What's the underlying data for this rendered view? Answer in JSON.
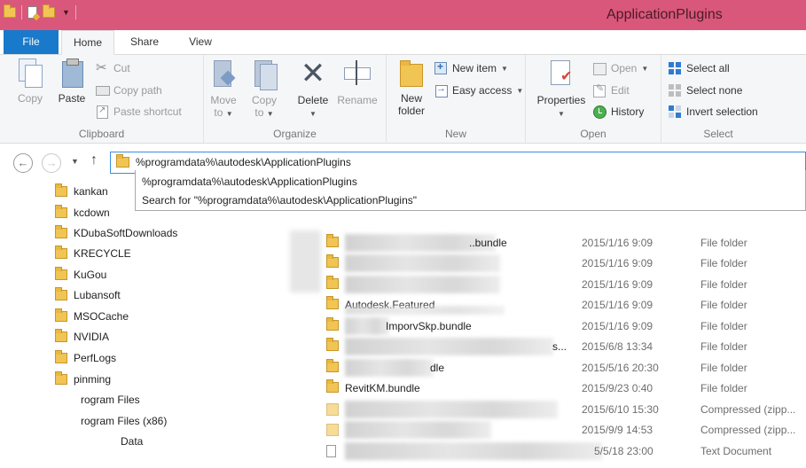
{
  "window": {
    "title": "ApplicationPlugins"
  },
  "tabs": {
    "file": "File",
    "home": "Home",
    "share": "Share",
    "view": "View"
  },
  "ribbon": {
    "clipboard": {
      "label": "Clipboard",
      "copy": "Copy",
      "paste": "Paste",
      "cut": "Cut",
      "copy_path": "Copy path",
      "paste_shortcut": "Paste shortcut"
    },
    "organize": {
      "label": "Organize",
      "move_to_line1": "Move",
      "move_to_line2": "to",
      "copy_to_line1": "Copy",
      "copy_to_line2": "to",
      "delete": "Delete",
      "rename": "Rename"
    },
    "new": {
      "label": "New",
      "new_folder_line1": "New",
      "new_folder_line2": "folder",
      "new_item": "New item",
      "easy_access": "Easy access"
    },
    "open": {
      "label": "Open",
      "properties": "Properties",
      "open": "Open",
      "edit": "Edit",
      "history": "History"
    },
    "select": {
      "label": "Select",
      "select_all": "Select all",
      "select_none": "Select none",
      "invert_selection": "Invert selection"
    }
  },
  "address": {
    "value": "%programdata%\\autodesk\\ApplicationPlugins",
    "suggestions": [
      "%programdata%\\autodesk\\ApplicationPlugins",
      "Search for \"%programdata%\\autodesk\\ApplicationPlugins\""
    ]
  },
  "icons": {
    "back": "back-arrow-icon",
    "forward": "forward-arrow-icon",
    "recent": "chevron-down-icon",
    "up": "up-arrow-icon",
    "folder": "folder-icon"
  },
  "nav_items": [
    "kankan",
    "kcdown",
    "KDubaSoftDownloads",
    "KRECYCLE",
    "KuGou",
    "Lubansoft",
    "MSOCache",
    "NVIDIA",
    "PerfLogs",
    "pinming",
    "rogram Files",
    "rogram Files (x86)",
    "Data"
  ],
  "files": [
    {
      "name": "",
      "suffix": "..bundle",
      "date": "2015/1/16 9:09",
      "type": "File folder"
    },
    {
      "name": "",
      "suffix": "",
      "date": "2015/1/16 9:09",
      "type": "File folder"
    },
    {
      "name": "",
      "suffix": "",
      "date": "2015/1/16 9:09",
      "type": "File folder"
    },
    {
      "name": "Autodesk.Featured",
      "suffix": "",
      "date": "2015/1/16 9:09",
      "type": "File folder"
    },
    {
      "name": "",
      "suffix": "ImporvSkp.bundle",
      "date": "2015/1/16 9:09",
      "type": "File folder"
    },
    {
      "name": "",
      "suffix": "s...",
      "date": "2015/6/8 13:34",
      "type": "File folder"
    },
    {
      "name": "",
      "suffix": "dle",
      "date": "2015/5/16 20:30",
      "type": "File folder"
    },
    {
      "name": "RevitKM.bundle",
      "suffix": "",
      "date": "2015/9/23 0:40",
      "type": "File folder"
    },
    {
      "name": "",
      "suffix": "",
      "date": "2015/6/10 15:30",
      "type": "Compressed (zipp..."
    },
    {
      "name": "",
      "suffix": "",
      "date": "2015/9/9 14:53",
      "type": "Compressed (zipp..."
    },
    {
      "name": "",
      "suffix": "",
      "date": "5/5/18 23:00",
      "type": "Text Document"
    }
  ],
  "colors": {
    "titlebar": "#d9577a",
    "file_tab": "#1979ca",
    "ribbon_bg": "#f5f6f7",
    "address_border": "#3a8ee6",
    "folder": "#f1c553"
  }
}
